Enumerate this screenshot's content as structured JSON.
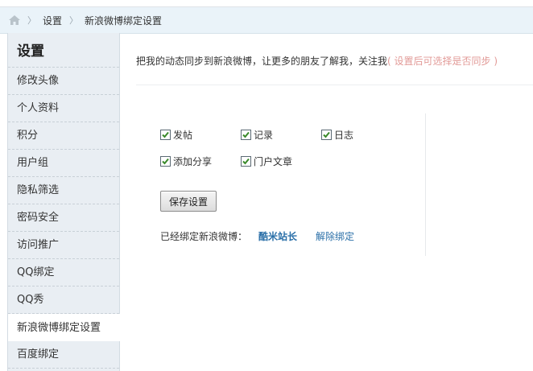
{
  "breadcrumb": {
    "items": [
      "设置",
      "新浪微博绑定设置"
    ],
    "separator": "〉"
  },
  "sidebar": {
    "title": "设置",
    "items": [
      {
        "label": "修改头像"
      },
      {
        "label": "个人资料"
      },
      {
        "label": "积分"
      },
      {
        "label": "用户组"
      },
      {
        "label": "隐私筛选"
      },
      {
        "label": "密码安全"
      },
      {
        "label": "访问推广"
      },
      {
        "label": "QQ绑定"
      },
      {
        "label": "QQ秀"
      },
      {
        "label": "新浪微博绑定设置",
        "active": true
      },
      {
        "label": "百度绑定"
      }
    ]
  },
  "main": {
    "intro": "把我的动态同步到新浪微博，让更多的朋友了解我，关注我",
    "intro_hint": "( 设置后可选择是否同步 )",
    "options": [
      {
        "label": "发帖",
        "checked": true
      },
      {
        "label": "记录",
        "checked": true
      },
      {
        "label": "日志",
        "checked": true
      },
      {
        "label": "添加分享",
        "checked": true
      },
      {
        "label": "门户文章",
        "checked": true
      }
    ],
    "save_label": "保存设置",
    "bound_label": "已经绑定新浪微博：",
    "bound_name": "酷米站长",
    "unbind_label": "解除绑定"
  },
  "colors": {
    "link": "#2a6fa8",
    "hint": "#e29a97",
    "sidebar_bg": "#e9eef3",
    "breadcrumb_bg": "#eaf3f9",
    "check": "#3a8a2a"
  },
  "icons": {
    "home": "home-icon",
    "checkbox": "checkbox-checked-icon"
  }
}
